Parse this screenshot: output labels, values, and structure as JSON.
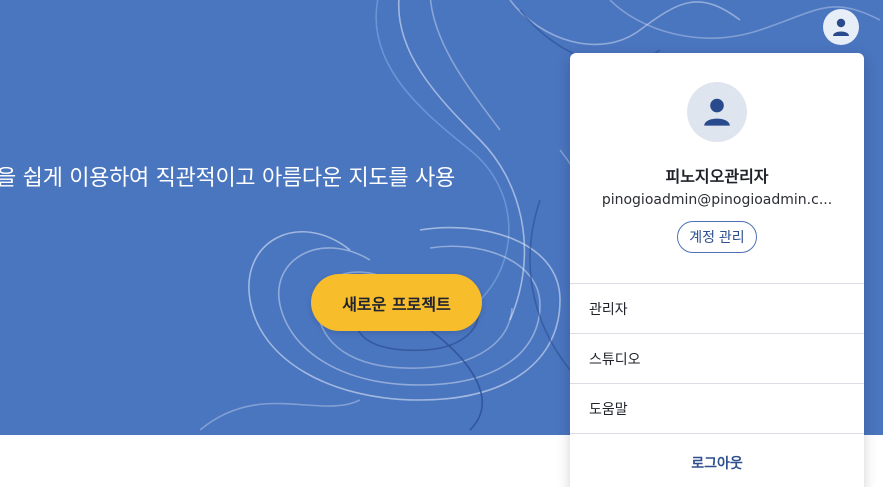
{
  "hero": {
    "tagline": "을 쉽게 이용하여 직관적이고 아름다운 지도를 사용",
    "new_project_label": "새로운 프로젝트"
  },
  "account": {
    "avatar_icon": "user-avatar-icon"
  },
  "menu": {
    "user_name": "피노지오관리자",
    "user_email": "pinogioadmin@pinogioadmin.c...",
    "manage_account_label": "계정 관리",
    "items": [
      {
        "label": "관리자"
      },
      {
        "label": "스튜디오"
      },
      {
        "label": "도움말"
      }
    ],
    "logout_label": "로그아웃"
  },
  "colors": {
    "hero_bg": "#4a75bf",
    "accent_button": "#f8bd2b",
    "brand_text": "#2f4f8f"
  }
}
